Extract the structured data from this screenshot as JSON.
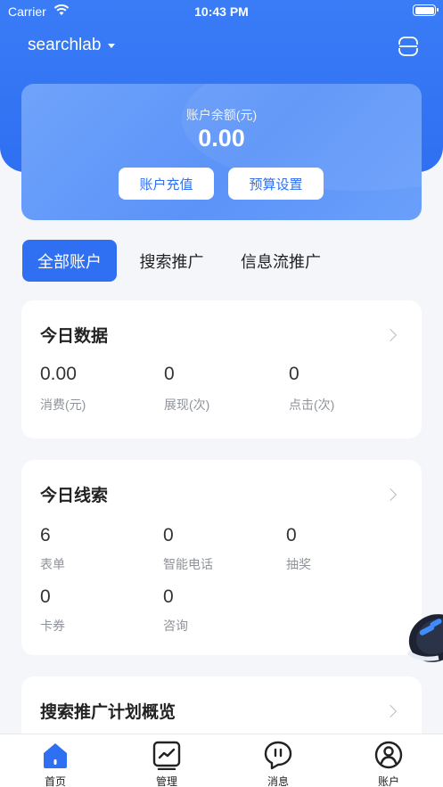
{
  "status_bar": {
    "carrier": "Carrier",
    "time": "10:43 PM"
  },
  "header": {
    "account_name": "searchlab",
    "menu_icon": "scan-icon"
  },
  "balance": {
    "label": "账户余额(元)",
    "value": "0.00",
    "recharge_label": "账户充值",
    "budget_label": "预算设置"
  },
  "segments": [
    {
      "label": "全部账户",
      "active": true
    },
    {
      "label": "搜索推广",
      "active": false
    },
    {
      "label": "信息流推广",
      "active": false
    }
  ],
  "today_data": {
    "title": "今日数据",
    "metrics": [
      {
        "value": "0.00",
        "label": "消费(元)"
      },
      {
        "value": "0",
        "label": "展现(次)"
      },
      {
        "value": "0",
        "label": "点击(次)"
      }
    ]
  },
  "today_leads": {
    "title": "今日线索",
    "metrics": [
      {
        "value": "6",
        "label": "表单"
      },
      {
        "value": "0",
        "label": "智能电话"
      },
      {
        "value": "0",
        "label": "抽奖"
      },
      {
        "value": "0",
        "label": "卡券"
      },
      {
        "value": "0",
        "label": "咨询"
      }
    ]
  },
  "plan_overview": {
    "title": "搜索推广计划概览"
  },
  "tabbar": [
    {
      "label": "首页",
      "icon": "home-icon",
      "active": true
    },
    {
      "label": "管理",
      "icon": "chart-icon",
      "active": false
    },
    {
      "label": "消息",
      "icon": "message-icon",
      "active": false
    },
    {
      "label": "账户",
      "icon": "account-icon",
      "active": false
    }
  ],
  "colors": {
    "primary": "#2f6ff2",
    "background": "#f4f6fa",
    "card": "#ffffff",
    "muted_text": "#8f939b"
  }
}
